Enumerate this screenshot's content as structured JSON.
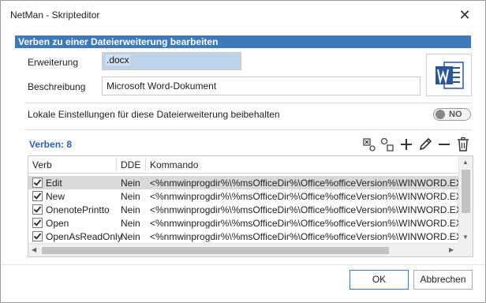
{
  "window": {
    "title": "NetMan - Skripteditor"
  },
  "section": {
    "header": "Verben zu einer Dateierweiterung bearbeiten"
  },
  "form": {
    "extension_label": "Erweiterung",
    "extension_value": ".docx",
    "description_label": "Beschreibung",
    "description_value": "Microsoft Word-Dokument",
    "keep_local_label": "Lokale Einstellungen für diese Dateierweiterung beibehalten",
    "keep_local_toggle": "NO"
  },
  "verbs": {
    "title": "Verben: 8",
    "columns": [
      "Verb",
      "DDE",
      "Kommando"
    ],
    "rows": [
      {
        "verb": "Edit",
        "dde": "Nein",
        "cmd": "<%nmwinprogdir%\\%msOfficeDir%\\Office%officeVersion%\\WINWORD.EXE>",
        "checked": true,
        "selected": true
      },
      {
        "verb": "New",
        "dde": "Nein",
        "cmd": "<%nmwinprogdir%\\%msOfficeDir%\\Office%officeVersion%\\WINWORD.EXE>",
        "checked": true,
        "selected": false
      },
      {
        "verb": "OnenotePrintto",
        "dde": "Nein",
        "cmd": "<%nmwinprogdir%\\%msOfficeDir%\\Office%officeVersion%\\WINWORD.EXE>",
        "checked": true,
        "selected": false
      },
      {
        "verb": "Open",
        "dde": "Nein",
        "cmd": "<%nmwinprogdir%\\%msOfficeDir%\\Office%officeVersion%\\WINWORD.EXE>",
        "checked": true,
        "selected": false
      },
      {
        "verb": "OpenAsReadOnly",
        "dde": "Nein",
        "cmd": "<%nmwinprogdir%\\%msOfficeDir%\\Office%officeVersion%\\WINWORD.EXE>",
        "checked": true,
        "selected": false
      }
    ],
    "toolbar_icons": [
      "select-all-icon",
      "deselect-icon",
      "add-icon",
      "edit-icon",
      "remove-icon",
      "delete-icon"
    ]
  },
  "buttons": {
    "ok": "OK",
    "cancel": "Abbrechen"
  },
  "colors": {
    "header_bg": "#3e7ab9",
    "accent": "#2a62b0",
    "word_blue": "#2b5797"
  }
}
